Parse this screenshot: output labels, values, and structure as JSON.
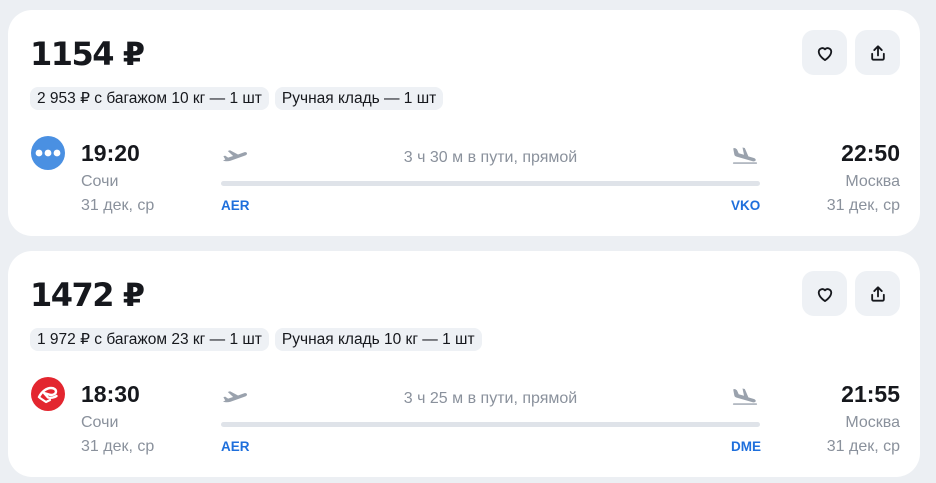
{
  "tickets": [
    {
      "price": "1154 ₽",
      "chips": [
        "2 953 ₽ с багажом 10 кг — 1 шт",
        "Ручная кладь — 1 шт"
      ],
      "airline_logo": "dots-logo",
      "airline_color": "#4a90e2",
      "departure": {
        "time": "19:20",
        "city": "Сочи",
        "date": "31 дек, ср",
        "code": "AER"
      },
      "arrival": {
        "time": "22:50",
        "city": "Москва",
        "date": "31 дек, ср",
        "code": "VKO"
      },
      "duration": "3 ч 30 м в пути, прямой"
    },
    {
      "price": "1472 ₽",
      "chips": [
        "1 972 ₽ с багажом 23 кг — 1 шт",
        "Ручная кладь 10 кг — 1 шт"
      ],
      "airline_logo": "red-bird-logo",
      "airline_color": "#e3262f",
      "departure": {
        "time": "18:30",
        "city": "Сочи",
        "date": "31 дек, ср",
        "code": "AER"
      },
      "arrival": {
        "time": "21:55",
        "city": "Москва",
        "date": "31 дек, ср",
        "code": "DME"
      },
      "duration": "3 ч 25 м в пути, прямой"
    }
  ],
  "icons": {
    "favorite": "heart-icon",
    "share": "share-icon",
    "takeoff": "plane-takeoff-icon",
    "landing": "plane-landing-icon"
  },
  "colors": {
    "accent": "#1e6fdc",
    "muted_text": "#8a919c",
    "chip_bg": "#eef1f5",
    "page_bg": "#eceff3"
  }
}
